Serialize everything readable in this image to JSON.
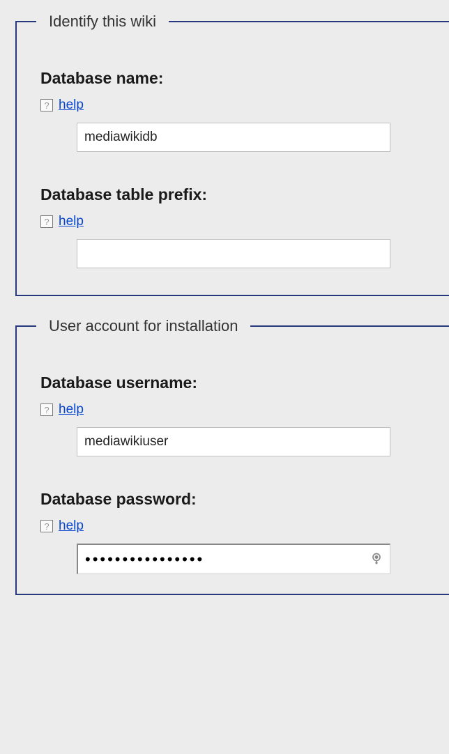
{
  "fieldsets": {
    "identify": {
      "legend": "Identify this wiki",
      "db_name": {
        "label": "Database name:",
        "help": "help",
        "value": "mediawikidb"
      },
      "db_prefix": {
        "label": "Database table prefix:",
        "help": "help",
        "value": ""
      }
    },
    "user_account": {
      "legend": "User account for installation",
      "db_username": {
        "label": "Database username:",
        "help": "help",
        "value": "mediawikiuser"
      },
      "db_password": {
        "label": "Database password:",
        "help": "help",
        "value": "••••••••••••••••"
      }
    }
  }
}
